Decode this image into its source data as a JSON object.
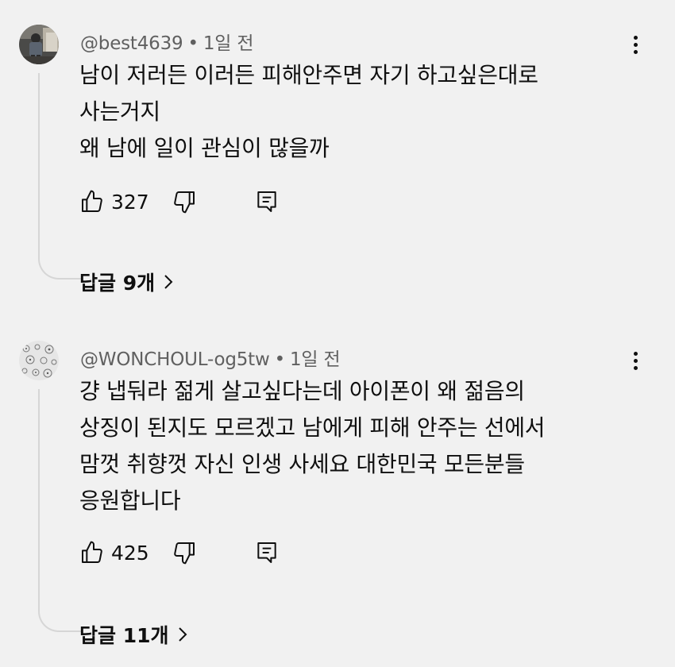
{
  "comments": [
    {
      "handle": "@best4639",
      "time": "1일 전",
      "lines": [
        "남이 저러든 이러든 피해안주면  자기 하고싶은대로",
        "사는거지",
        "왜 남에 일이 관심이 많을까"
      ],
      "likes": "327",
      "replies_label": "답글 9개",
      "avatar_icon": "photo-avatar"
    },
    {
      "handle": "@WONCHOUL-og5tw",
      "time": "1일 전",
      "lines": [
        "걍 냅둬라 젊게 살고싶다는데 아이폰이 왜 젊음의",
        "상징이 된지도 모르겠고 남에게 피해 안주는 선에서",
        "맘껏 취향껏 자신 인생 사세요 대한민국 모든분들",
        "응원합니다"
      ],
      "likes": "425",
      "replies_label": "답글 11개",
      "avatar_icon": "pattern-avatar"
    }
  ],
  "separator": "•",
  "icons": {
    "like": "thumbs-up-icon",
    "dislike": "thumbs-down-icon",
    "reply": "reply-icon",
    "more": "more-vert-icon",
    "expand": "chevron-right-icon"
  }
}
